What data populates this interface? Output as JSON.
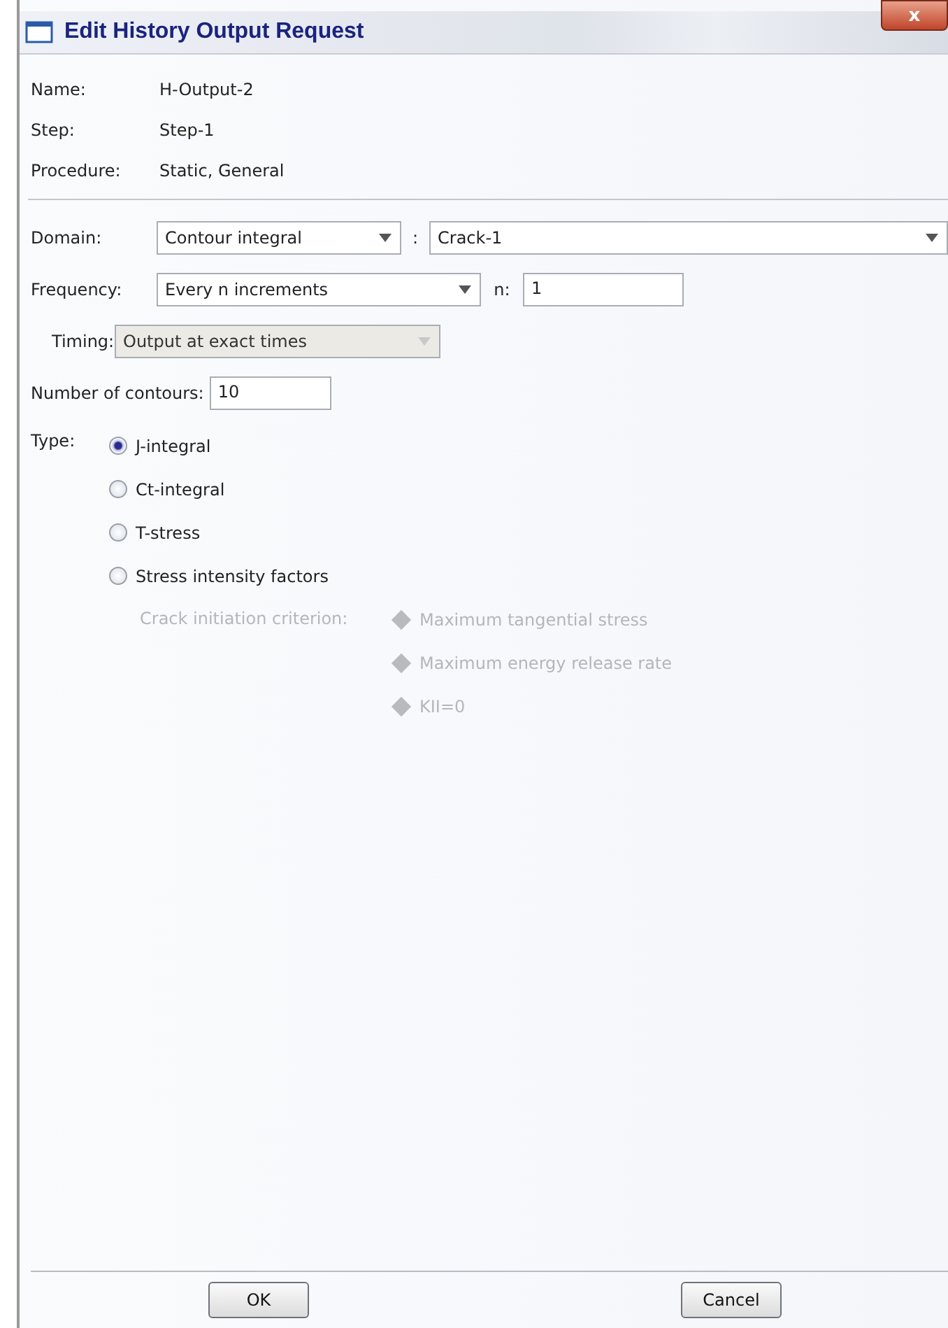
{
  "window": {
    "title": "Edit History Output Request",
    "close": "x"
  },
  "info": [
    {
      "label": "Name:",
      "value": "H-Output-2"
    },
    {
      "label": "Step:",
      "value": "Step-1"
    },
    {
      "label": "Procedure:",
      "value": "Static, General"
    }
  ],
  "domain": {
    "label": "Domain:",
    "value": "Contour integral",
    "separator": ":",
    "target": "Crack-1"
  },
  "frequency": {
    "label": "Frequency:",
    "value": "Every n increments",
    "n_label": "n:",
    "n_value": "1"
  },
  "timing": {
    "label": "Timing:",
    "value": "Output at exact times",
    "disabled": true
  },
  "contours": {
    "label": "Number of contours:",
    "value": "10"
  },
  "type": {
    "label": "Type:",
    "options": [
      {
        "label": "J-integral",
        "selected": true
      },
      {
        "label": "Ct-integral",
        "selected": false
      },
      {
        "label": "T-stress",
        "selected": false
      },
      {
        "label": "Stress intensity factors",
        "selected": false
      }
    ]
  },
  "criterion": {
    "label": "Crack initiation criterion:",
    "disabled": true,
    "options": [
      {
        "label": "Maximum tangential stress"
      },
      {
        "label": "Maximum energy release rate"
      },
      {
        "label": "KII=0"
      }
    ]
  },
  "buttons": [
    "OK",
    "Cancel"
  ]
}
